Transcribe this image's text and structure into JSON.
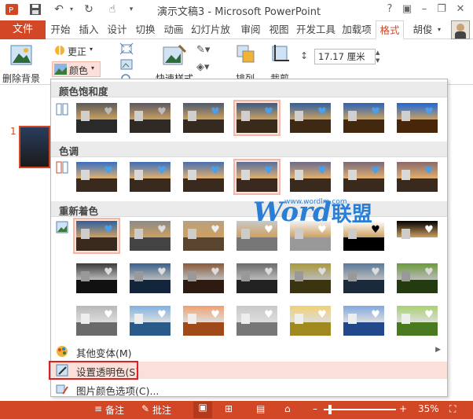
{
  "title_bar": {
    "title": "演示文稿3 - Microsoft PowerPoint",
    "icons": [
      "powerpoint-icon",
      "save-icon",
      "undo-icon",
      "repeat-icon",
      "touch-mode-icon"
    ],
    "window_icons": [
      "help-icon",
      "ribbon-display-icon",
      "minimize-icon",
      "restore-icon",
      "close-icon"
    ]
  },
  "tabs": {
    "file": "文件",
    "items": [
      "开始",
      "插入",
      "设计",
      "切换",
      "动画",
      "幻灯片放",
      "审阅",
      "视图",
      "开发工具",
      "加载项",
      "格式"
    ],
    "active": "格式",
    "user": "胡俊"
  },
  "ribbon": {
    "remove_bg": "删除背景",
    "correct": "更正",
    "color": "颜色",
    "quick_styles": "快速样式",
    "arrange": "排列",
    "crop": "裁剪",
    "size_value": "17.17 厘米"
  },
  "slide_pane": {
    "slide_number": "1"
  },
  "dropdown": {
    "sections": [
      {
        "title": "颜色饱和度",
        "selected_index": 3
      },
      {
        "title": "色调",
        "selected_index": 3
      },
      {
        "title": "重新着色",
        "selected_index": 0
      }
    ],
    "menu": [
      {
        "label": "其他变体(M)",
        "icon": "palette-icon",
        "submenu": true
      },
      {
        "label": "设置透明色(S)",
        "icon": "set-transparent-color-icon",
        "submenu": false
      },
      {
        "label": "图片颜色选项(C)...",
        "icon": "picture-color-options-icon",
        "submenu": false
      }
    ],
    "hovered": "设置透明色(S)"
  },
  "watermark": {
    "word": "Word",
    "cn": "联盟",
    "url": "www.wordlm.com"
  },
  "status_bar": {
    "notes": "备注",
    "comments": "批注",
    "zoom": "35%"
  },
  "colors": {
    "accent": "#d24726",
    "selected_border": "#f4b6a6",
    "hover_bg": "#fbe0d9",
    "highlight_box": "#e02020",
    "watermark": "#2a7fd4"
  }
}
